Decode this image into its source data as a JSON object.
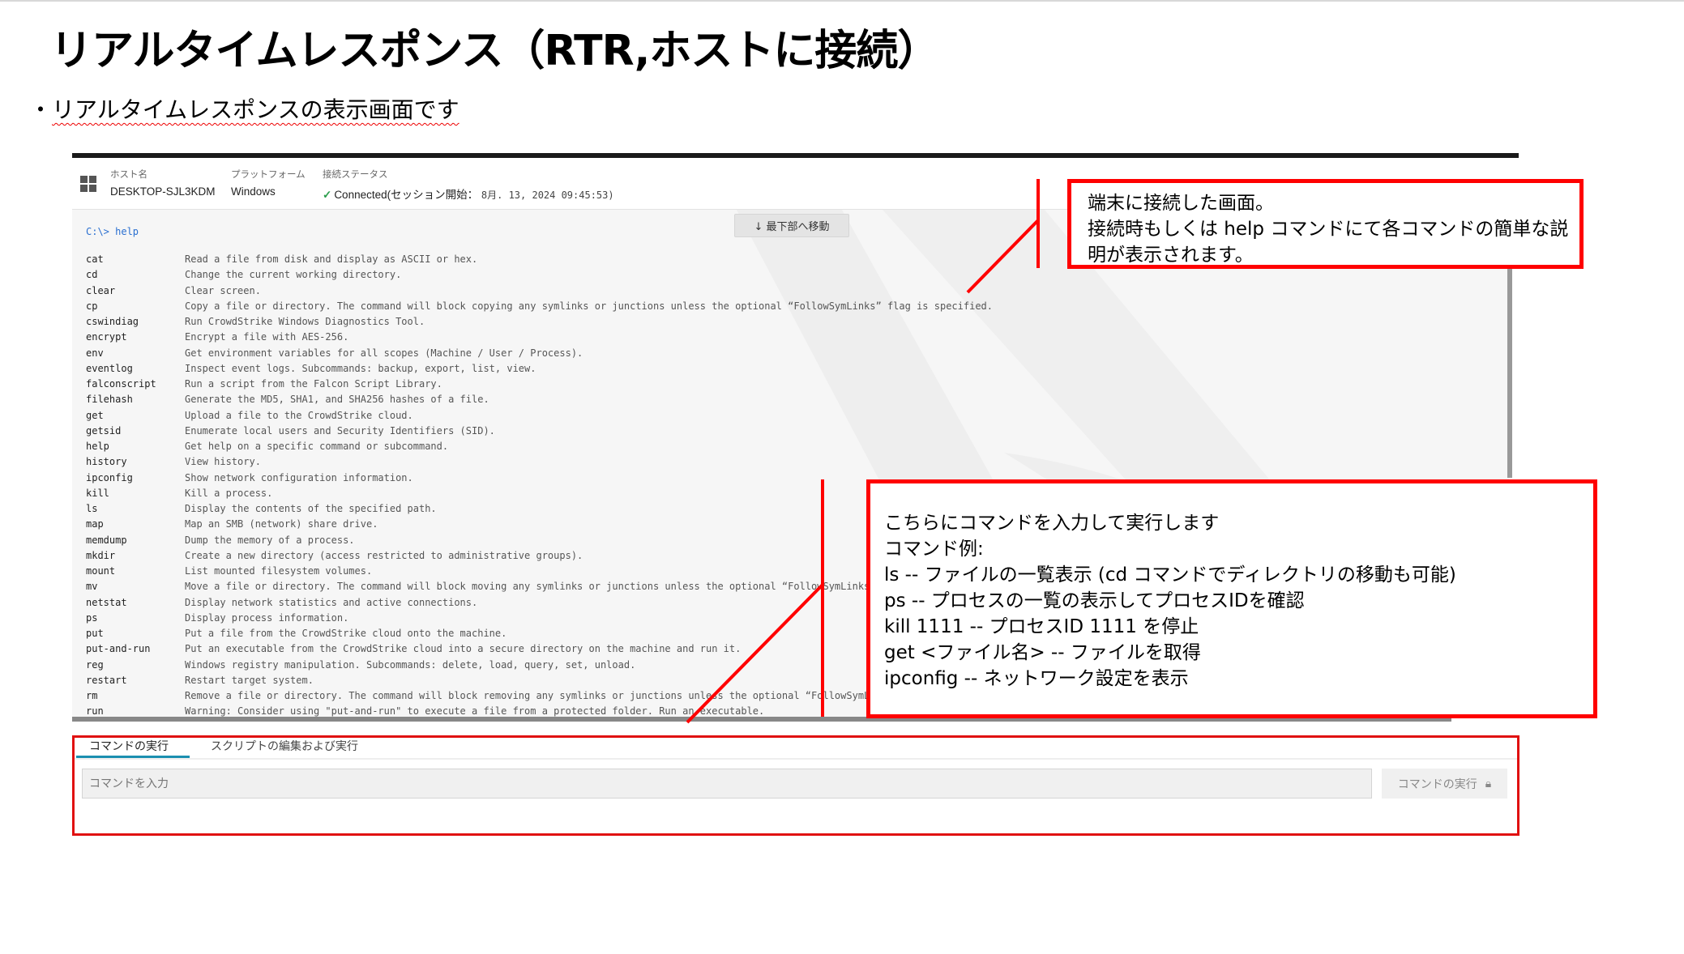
{
  "slide": {
    "title": "リアルタイムレスポンス（RTR,ホストに接続）",
    "bullet": "リアルタイムレスポンスの表示画面です"
  },
  "header": {
    "host_label": "ホスト名",
    "host_value": "DESKTOP-SJL3KDM",
    "platform_label": "プラットフォーム",
    "platform_value": "Windows",
    "status_label": "接続ステータス",
    "status_value": "Connected",
    "session_prefix": "(セッション開始：",
    "session_time": "8月. 13, 2024 09:45:53)",
    "os_icon": "windows-icon"
  },
  "terminal": {
    "prompt": "C:\\> help",
    "scroll_bottom_label": "↓ 最下部へ移動",
    "rows": [
      {
        "cmd": "cat",
        "desc": "Read a file from disk and display as ASCII or hex."
      },
      {
        "cmd": "cd",
        "desc": "Change the current working directory."
      },
      {
        "cmd": "clear",
        "desc": "Clear screen."
      },
      {
        "cmd": "cp",
        "desc": "Copy a file or directory. The command will block copying any symlinks or junctions unless the optional “FollowSymLinks” flag is specified."
      },
      {
        "cmd": "cswindiag",
        "desc": "Run CrowdStrike Windows Diagnostics Tool."
      },
      {
        "cmd": "encrypt",
        "desc": "Encrypt a file with AES-256."
      },
      {
        "cmd": "env",
        "desc": "Get environment variables for all scopes (Machine / User / Process)."
      },
      {
        "cmd": "eventlog",
        "desc": "Inspect event logs. Subcommands: backup, export, list, view."
      },
      {
        "cmd": "falconscript",
        "desc": "Run a script from the Falcon Script Library."
      },
      {
        "cmd": "filehash",
        "desc": "Generate the MD5, SHA1, and SHA256 hashes of a file."
      },
      {
        "cmd": "get",
        "desc": "Upload a file to the CrowdStrike cloud."
      },
      {
        "cmd": "getsid",
        "desc": "Enumerate local users and Security Identifiers (SID)."
      },
      {
        "cmd": "help",
        "desc": "Get help on a specific command or subcommand."
      },
      {
        "cmd": "history",
        "desc": "View history."
      },
      {
        "cmd": "ipconfig",
        "desc": "Show network configuration information."
      },
      {
        "cmd": "kill",
        "desc": "Kill a process."
      },
      {
        "cmd": "ls",
        "desc": "Display the contents of the specified path."
      },
      {
        "cmd": "map",
        "desc": "Map an SMB (network) share drive."
      },
      {
        "cmd": "memdump",
        "desc": "Dump the memory of a process."
      },
      {
        "cmd": "mkdir",
        "desc": "Create a new directory (access restricted to administrative groups)."
      },
      {
        "cmd": "mount",
        "desc": "List mounted filesystem volumes."
      },
      {
        "cmd": "mv",
        "desc": "Move a file or directory. The command will block moving any symlinks or junctions unless the optional “FollowSymLinks” fl"
      },
      {
        "cmd": "netstat",
        "desc": "Display network statistics and active connections."
      },
      {
        "cmd": "ps",
        "desc": "Display process information."
      },
      {
        "cmd": "put",
        "desc": "Put a file from the CrowdStrike cloud onto the machine."
      },
      {
        "cmd": "put-and-run",
        "desc": "Put an executable from the CrowdStrike cloud into a secure directory on the machine and run it."
      },
      {
        "cmd": "reg",
        "desc": "Windows registry manipulation. Subcommands: delete, load, query, set, unload."
      },
      {
        "cmd": "restart",
        "desc": "Restart target system."
      },
      {
        "cmd": "rm",
        "desc": "Remove a file or directory. The command will block removing any symlinks or junctions unless the optional “FollowSymLinks"
      },
      {
        "cmd": "run",
        "desc": "Warning: Consider using \"put-and-run\" to execute a file from a protected folder. Run an executable."
      }
    ]
  },
  "command_panel": {
    "tabs": [
      {
        "label": "コマンドの実行",
        "active": true
      },
      {
        "label": "スクリプトの編集および実行",
        "active": false
      }
    ],
    "input_placeholder": "コマンドを入力",
    "run_button": "コマンドの実行",
    "run_icon": "lock-icon"
  },
  "callouts": {
    "top": [
      "端末に接続した画面。",
      "接続時もしくは help コマンドにて各コマンドの簡単な説",
      "明が表示されます。"
    ],
    "bottom": [
      "こちらにコマンドを入力して実行します",
      "コマンド例:",
      "ls -- ファイルの一覧表示 (cd コマンドでディレクトリの移動も可能)",
      "ps -- プロセスの一覧の表示してプロセスIDを確認",
      "kill 1111 -- プロセスID 1111 を停止",
      "get <ファイル名> -- ファイルを取得",
      "ipconfig -- ネットワーク設定を表示"
    ]
  },
  "colors": {
    "annotation_red": "#ff0000",
    "tab_accent": "#1b8fb0",
    "connected_green": "#2a9d4b"
  }
}
